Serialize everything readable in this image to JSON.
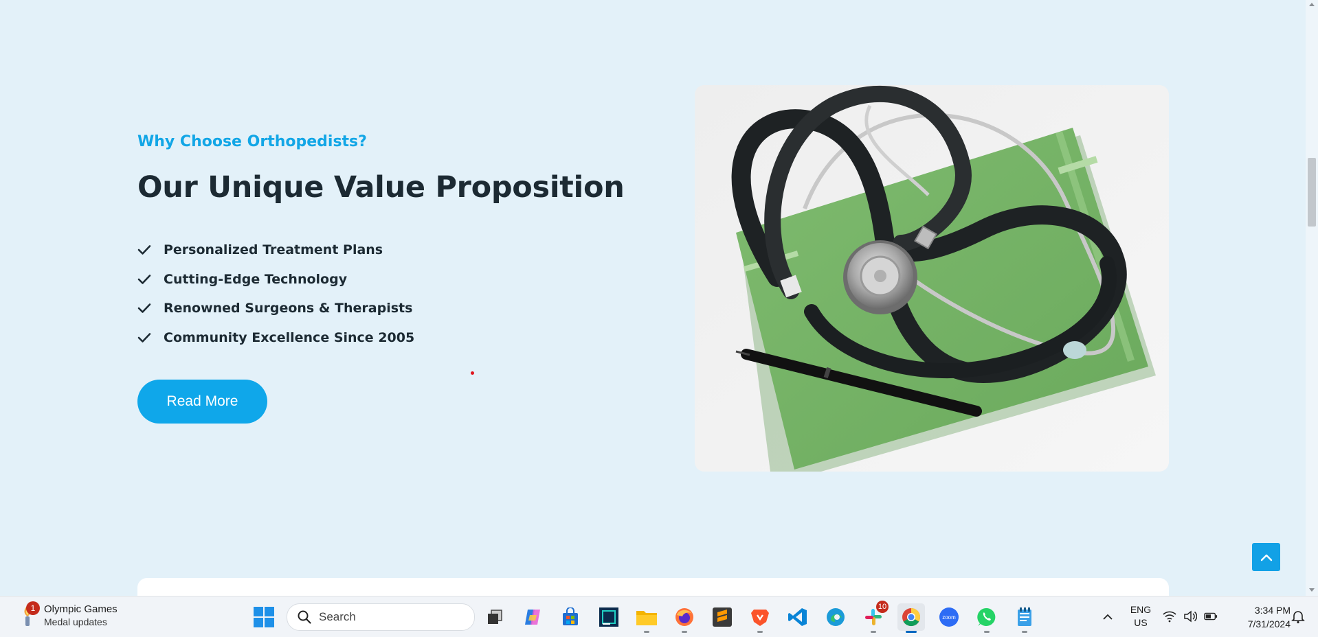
{
  "section": {
    "eyebrow": "Why Choose Orthopedists?",
    "headline": "Our Unique Value Proposition",
    "features": [
      "Personalized Treatment Plans",
      "Cutting-Edge Technology",
      "Renowned Surgeons & Therapists",
      "Community Excellence Since 2005"
    ],
    "cta_label": "Read More",
    "accent_color": "#12a6e6"
  },
  "taskbar": {
    "widget": {
      "badge": "1",
      "title": "Olympic Games",
      "subtitle": "Medal updates"
    },
    "search_placeholder": "Search",
    "apps": [
      {
        "name": "task-view",
        "icon": "task-view-icon"
      },
      {
        "name": "copilot",
        "icon": "copilot-icon"
      },
      {
        "name": "microsoft-store",
        "icon": "store-icon"
      },
      {
        "name": "pycharm",
        "icon": "pycharm-icon"
      },
      {
        "name": "file-explorer",
        "icon": "folder-icon"
      },
      {
        "name": "firefox",
        "icon": "firefox-icon"
      },
      {
        "name": "sublime-text",
        "icon": "sublime-icon"
      },
      {
        "name": "brave",
        "icon": "brave-icon"
      },
      {
        "name": "vscode",
        "icon": "vscode-icon"
      },
      {
        "name": "edge",
        "icon": "edge-icon"
      },
      {
        "name": "slack",
        "icon": "slack-icon",
        "badge": "10"
      },
      {
        "name": "chrome",
        "icon": "chrome-icon",
        "active": true
      },
      {
        "name": "zoom",
        "icon": "zoom-icon",
        "label": "zoom"
      },
      {
        "name": "whatsapp",
        "icon": "whatsapp-icon"
      },
      {
        "name": "notepad",
        "icon": "notepad-icon"
      }
    ],
    "lang_line1": "ENG",
    "lang_line2": "US",
    "time": "3:34 PM",
    "date": "7/31/2024"
  }
}
